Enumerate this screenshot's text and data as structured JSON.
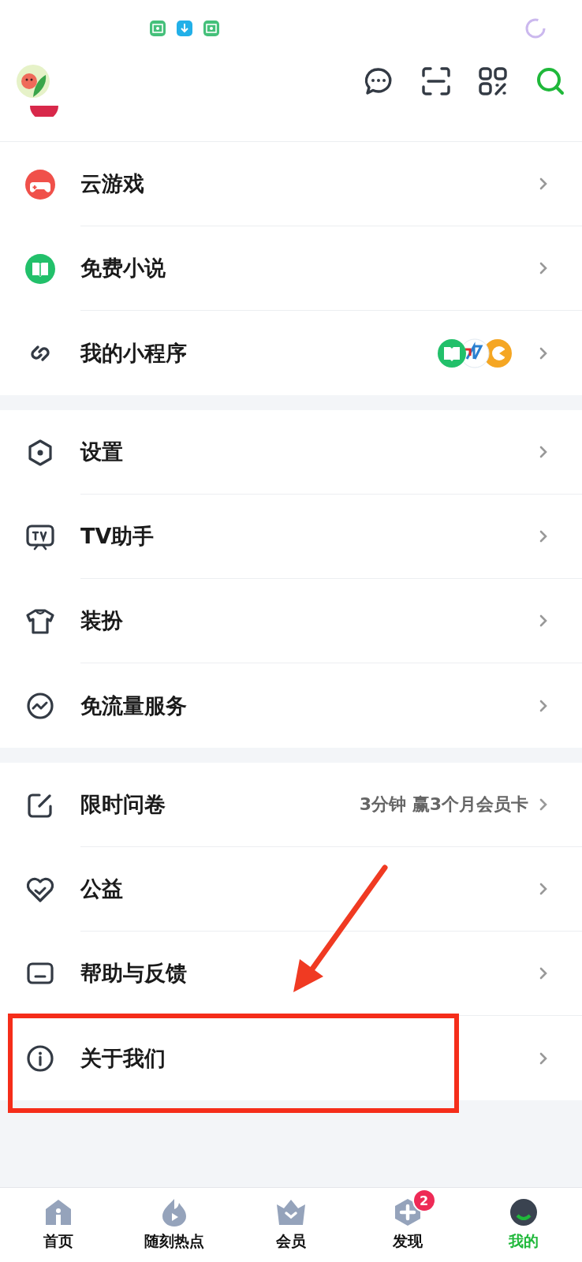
{
  "sections": [
    {
      "items": [
        {
          "label": "云游戏"
        },
        {
          "label": "免费小说"
        },
        {
          "label": "我的小程序",
          "kind": "apps"
        }
      ]
    },
    {
      "items": [
        {
          "label": "设置"
        },
        {
          "label": "TV助手"
        },
        {
          "label": "装扮"
        },
        {
          "label": "免流量服务"
        }
      ]
    },
    {
      "items": [
        {
          "label": "限时问卷",
          "detail": "3分钟 赢3个月会员卡"
        },
        {
          "label": "公益"
        },
        {
          "label": "帮助与反馈"
        },
        {
          "label": "关于我们",
          "highlighted": true
        }
      ]
    }
  ],
  "tabs": [
    {
      "label": "首页",
      "selected": false
    },
    {
      "label": "随刻热点",
      "selected": false
    },
    {
      "label": "会员",
      "selected": false
    },
    {
      "label": "发现",
      "selected": false,
      "badge": "2"
    },
    {
      "label": "我的",
      "selected": true
    }
  ]
}
